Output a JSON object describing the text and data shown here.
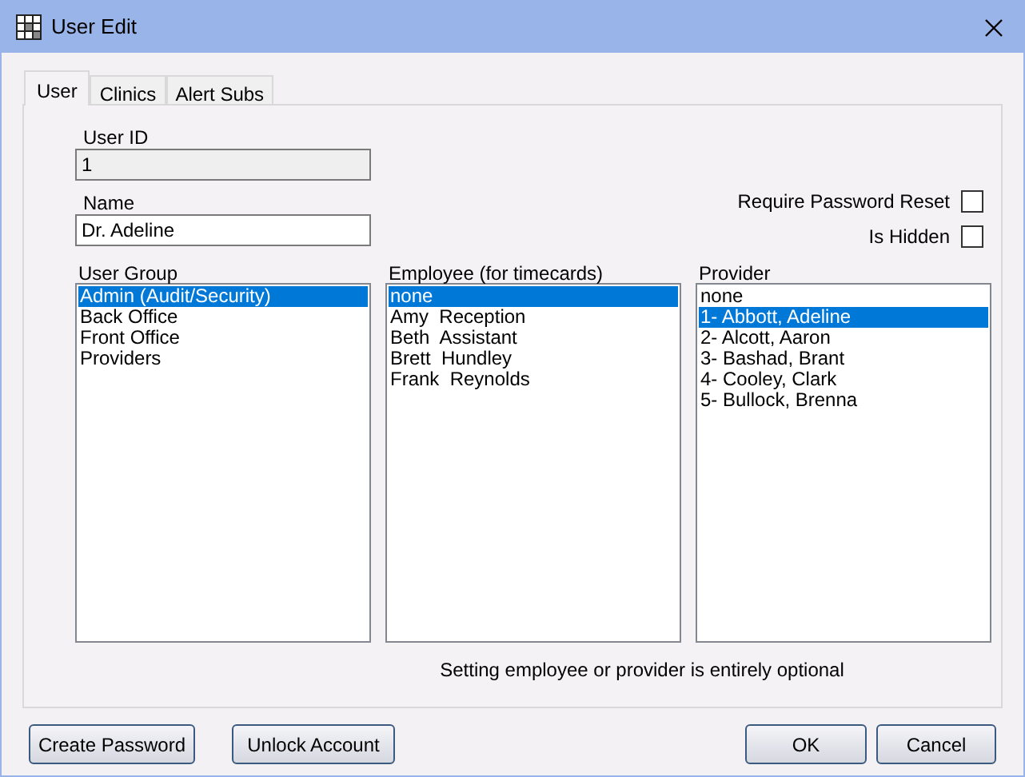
{
  "window": {
    "title": "User Edit"
  },
  "tabs": [
    {
      "label": "User",
      "selected": true
    },
    {
      "label": "Clinics",
      "selected": false
    },
    {
      "label": "Alert Subs",
      "selected": false
    }
  ],
  "user_id": {
    "label": "User ID",
    "value": "1",
    "readonly": true
  },
  "name": {
    "label": "Name",
    "value": "Dr. Adeline",
    "readonly": false
  },
  "checkboxes": [
    {
      "label": "Require Password Reset",
      "checked": false
    },
    {
      "label": "Is Hidden",
      "checked": false
    }
  ],
  "lists": [
    {
      "label": "User Group",
      "items": [
        {
          "text": "Admin (Audit/Security)",
          "selected": true
        },
        {
          "text": "Back Office",
          "selected": false
        },
        {
          "text": "Front Office",
          "selected": false
        },
        {
          "text": "Providers",
          "selected": false
        }
      ]
    },
    {
      "label": "Employee (for timecards)",
      "items": [
        {
          "text": "none",
          "selected": true
        },
        {
          "text": "Amy  Reception",
          "selected": false
        },
        {
          "text": "Beth  Assistant",
          "selected": false
        },
        {
          "text": "Brett  Hundley",
          "selected": false
        },
        {
          "text": "Frank  Reynolds",
          "selected": false
        }
      ]
    },
    {
      "label": "Provider",
      "items": [
        {
          "text": "none",
          "selected": false
        },
        {
          "text": "1- Abbott, Adeline",
          "selected": true
        },
        {
          "text": "2- Alcott, Aaron",
          "selected": false
        },
        {
          "text": "3- Bashad, Brant",
          "selected": false
        },
        {
          "text": "4- Cooley, Clark",
          "selected": false
        },
        {
          "text": "5- Bullock, Brenna",
          "selected": false
        }
      ]
    }
  ],
  "note": "Setting employee or provider is entirely optional",
  "buttons_left": [
    "Create Password",
    "Unlock Account"
  ],
  "buttons_right": [
    "OK",
    "Cancel"
  ]
}
